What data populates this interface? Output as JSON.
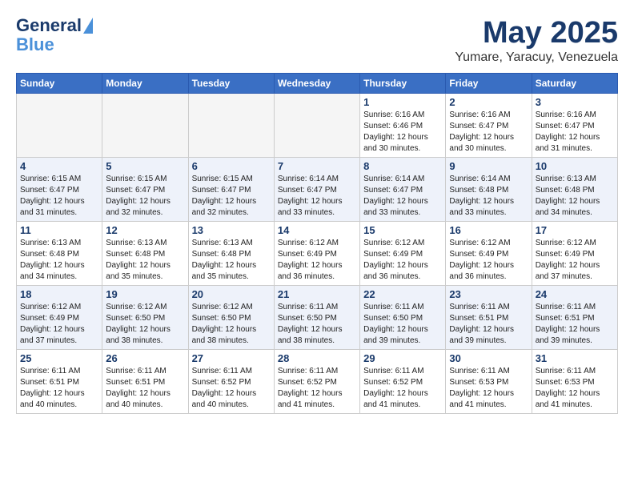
{
  "header": {
    "logo_line1": "General",
    "logo_line2": "Blue",
    "main_title": "May 2025",
    "subtitle": "Yumare, Yaracuy, Venezuela"
  },
  "days_of_week": [
    "Sunday",
    "Monday",
    "Tuesday",
    "Wednesday",
    "Thursday",
    "Friday",
    "Saturday"
  ],
  "weeks": [
    [
      {
        "day": "",
        "info": ""
      },
      {
        "day": "",
        "info": ""
      },
      {
        "day": "",
        "info": ""
      },
      {
        "day": "",
        "info": ""
      },
      {
        "day": "1",
        "info": "Sunrise: 6:16 AM\nSunset: 6:46 PM\nDaylight: 12 hours\nand 30 minutes."
      },
      {
        "day": "2",
        "info": "Sunrise: 6:16 AM\nSunset: 6:47 PM\nDaylight: 12 hours\nand 30 minutes."
      },
      {
        "day": "3",
        "info": "Sunrise: 6:16 AM\nSunset: 6:47 PM\nDaylight: 12 hours\nand 31 minutes."
      }
    ],
    [
      {
        "day": "4",
        "info": "Sunrise: 6:15 AM\nSunset: 6:47 PM\nDaylight: 12 hours\nand 31 minutes."
      },
      {
        "day": "5",
        "info": "Sunrise: 6:15 AM\nSunset: 6:47 PM\nDaylight: 12 hours\nand 32 minutes."
      },
      {
        "day": "6",
        "info": "Sunrise: 6:15 AM\nSunset: 6:47 PM\nDaylight: 12 hours\nand 32 minutes."
      },
      {
        "day": "7",
        "info": "Sunrise: 6:14 AM\nSunset: 6:47 PM\nDaylight: 12 hours\nand 33 minutes."
      },
      {
        "day": "8",
        "info": "Sunrise: 6:14 AM\nSunset: 6:47 PM\nDaylight: 12 hours\nand 33 minutes."
      },
      {
        "day": "9",
        "info": "Sunrise: 6:14 AM\nSunset: 6:48 PM\nDaylight: 12 hours\nand 33 minutes."
      },
      {
        "day": "10",
        "info": "Sunrise: 6:13 AM\nSunset: 6:48 PM\nDaylight: 12 hours\nand 34 minutes."
      }
    ],
    [
      {
        "day": "11",
        "info": "Sunrise: 6:13 AM\nSunset: 6:48 PM\nDaylight: 12 hours\nand 34 minutes."
      },
      {
        "day": "12",
        "info": "Sunrise: 6:13 AM\nSunset: 6:48 PM\nDaylight: 12 hours\nand 35 minutes."
      },
      {
        "day": "13",
        "info": "Sunrise: 6:13 AM\nSunset: 6:48 PM\nDaylight: 12 hours\nand 35 minutes."
      },
      {
        "day": "14",
        "info": "Sunrise: 6:12 AM\nSunset: 6:49 PM\nDaylight: 12 hours\nand 36 minutes."
      },
      {
        "day": "15",
        "info": "Sunrise: 6:12 AM\nSunset: 6:49 PM\nDaylight: 12 hours\nand 36 minutes."
      },
      {
        "day": "16",
        "info": "Sunrise: 6:12 AM\nSunset: 6:49 PM\nDaylight: 12 hours\nand 36 minutes."
      },
      {
        "day": "17",
        "info": "Sunrise: 6:12 AM\nSunset: 6:49 PM\nDaylight: 12 hours\nand 37 minutes."
      }
    ],
    [
      {
        "day": "18",
        "info": "Sunrise: 6:12 AM\nSunset: 6:49 PM\nDaylight: 12 hours\nand 37 minutes."
      },
      {
        "day": "19",
        "info": "Sunrise: 6:12 AM\nSunset: 6:50 PM\nDaylight: 12 hours\nand 38 minutes."
      },
      {
        "day": "20",
        "info": "Sunrise: 6:12 AM\nSunset: 6:50 PM\nDaylight: 12 hours\nand 38 minutes."
      },
      {
        "day": "21",
        "info": "Sunrise: 6:11 AM\nSunset: 6:50 PM\nDaylight: 12 hours\nand 38 minutes."
      },
      {
        "day": "22",
        "info": "Sunrise: 6:11 AM\nSunset: 6:50 PM\nDaylight: 12 hours\nand 39 minutes."
      },
      {
        "day": "23",
        "info": "Sunrise: 6:11 AM\nSunset: 6:51 PM\nDaylight: 12 hours\nand 39 minutes."
      },
      {
        "day": "24",
        "info": "Sunrise: 6:11 AM\nSunset: 6:51 PM\nDaylight: 12 hours\nand 39 minutes."
      }
    ],
    [
      {
        "day": "25",
        "info": "Sunrise: 6:11 AM\nSunset: 6:51 PM\nDaylight: 12 hours\nand 40 minutes."
      },
      {
        "day": "26",
        "info": "Sunrise: 6:11 AM\nSunset: 6:51 PM\nDaylight: 12 hours\nand 40 minutes."
      },
      {
        "day": "27",
        "info": "Sunrise: 6:11 AM\nSunset: 6:52 PM\nDaylight: 12 hours\nand 40 minutes."
      },
      {
        "day": "28",
        "info": "Sunrise: 6:11 AM\nSunset: 6:52 PM\nDaylight: 12 hours\nand 41 minutes."
      },
      {
        "day": "29",
        "info": "Sunrise: 6:11 AM\nSunset: 6:52 PM\nDaylight: 12 hours\nand 41 minutes."
      },
      {
        "day": "30",
        "info": "Sunrise: 6:11 AM\nSunset: 6:53 PM\nDaylight: 12 hours\nand 41 minutes."
      },
      {
        "day": "31",
        "info": "Sunrise: 6:11 AM\nSunset: 6:53 PM\nDaylight: 12 hours\nand 41 minutes."
      }
    ]
  ]
}
